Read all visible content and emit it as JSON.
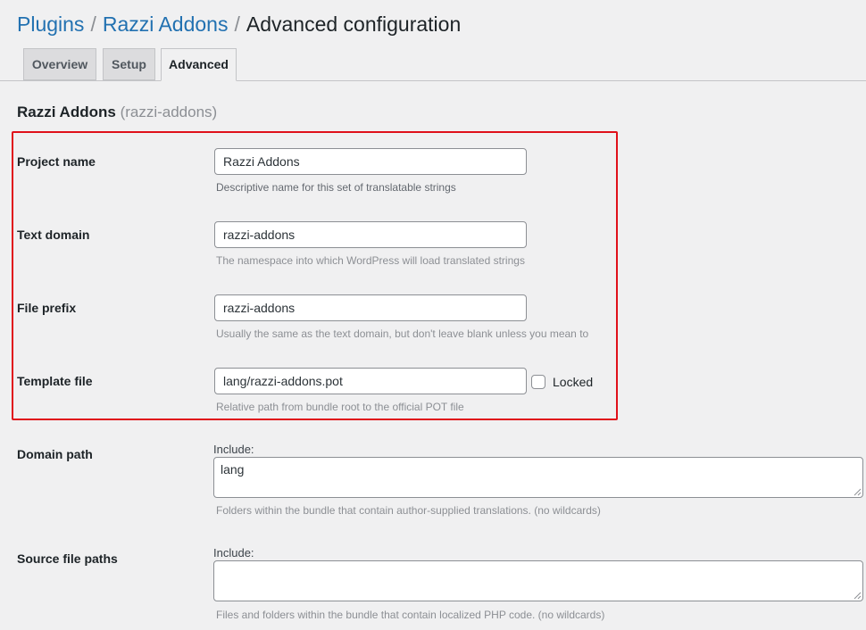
{
  "breadcrumb": {
    "plugins": "Plugins",
    "separator": "/",
    "plugin": "Razzi Addons",
    "current": "Advanced configuration"
  },
  "tabs": [
    {
      "label": "Overview",
      "active": false
    },
    {
      "label": "Setup",
      "active": false
    },
    {
      "label": "Advanced",
      "active": true
    }
  ],
  "project": {
    "name": "Razzi Addons",
    "slug": "(razzi-addons)"
  },
  "fields": {
    "project_name": {
      "label": "Project name",
      "value": "Razzi Addons",
      "description": "Descriptive name for this set of translatable strings"
    },
    "text_domain": {
      "label": "Text domain",
      "value": "razzi-addons",
      "description": "The namespace into which WordPress will load translated strings"
    },
    "file_prefix": {
      "label": "File prefix",
      "value": "razzi-addons",
      "description": "Usually the same as the text domain, but don't leave blank unless you mean to"
    },
    "template_file": {
      "label": "Template file",
      "value": "lang/razzi-addons.pot",
      "locked_label": "Locked",
      "locked": false,
      "description": "Relative path from bundle root to the official POT file"
    },
    "domain_path": {
      "label": "Domain path",
      "include_label": "Include:",
      "value": "lang",
      "description": "Folders within the bundle that contain author-supplied translations. (no wildcards)"
    },
    "source_file_paths": {
      "label": "Source file paths",
      "include_label": "Include:",
      "value": "",
      "description": "Files and folders within the bundle that contain localized PHP code. (no wildcards)"
    }
  },
  "colors": {
    "link": "#2271b1",
    "highlight_border": "#e0101a",
    "background": "#f0f0f1"
  }
}
